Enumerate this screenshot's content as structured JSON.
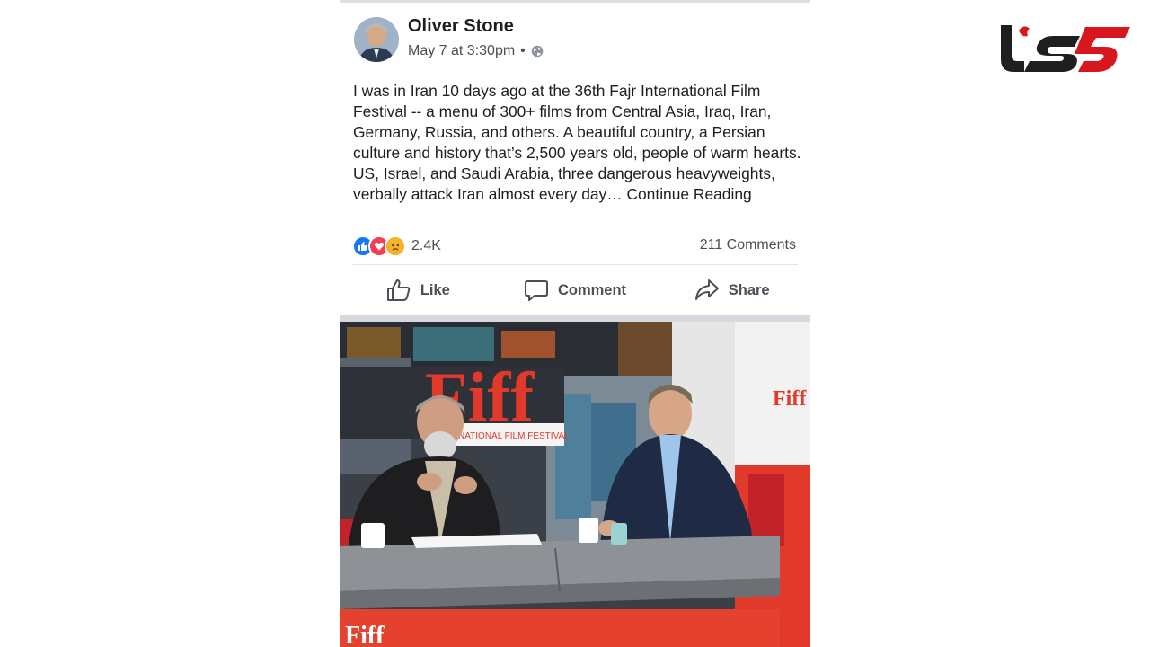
{
  "post": {
    "author": "Oliver Stone",
    "timestamp": "May 7 at 3:30pm",
    "separator": "•",
    "privacy_icon": "globe-icon",
    "body": "I was in Iran 10 days ago at the 36th Fajr International Film Festival -- a menu of 300+ films from Central Asia, Iraq, Iran, Germany, Russia, and others. A beautiful country, a Persian culture and history that’s 2,500 years old, people of warm hearts. US, Israel, and Saudi Arabia, three dangerous heavyweights, verbally attack Iran almost every day… Continue Reading",
    "reactions": {
      "icons": [
        "like-reaction-icon",
        "love-reaction-icon",
        "sad-reaction-icon"
      ],
      "count": "2.4K"
    },
    "comments_count": "211 Comments",
    "actions": {
      "like_label": "Like",
      "comment_label": "Comment",
      "share_label": "Share"
    },
    "photo": {
      "sign_main": "Fiff",
      "sign_sub": "INTERNATIONAL FILM FESTIVAL",
      "sign_side": "Fiff",
      "sign_bottom": "Fiff"
    }
  },
  "colors": {
    "facebook_blue": "#385898",
    "like_blue": "#1877f2",
    "love_red": "#f33e58",
    "sad_yellow": "#f7b125",
    "set_red": "#e23a2a",
    "logo_red": "#d8161d"
  }
}
